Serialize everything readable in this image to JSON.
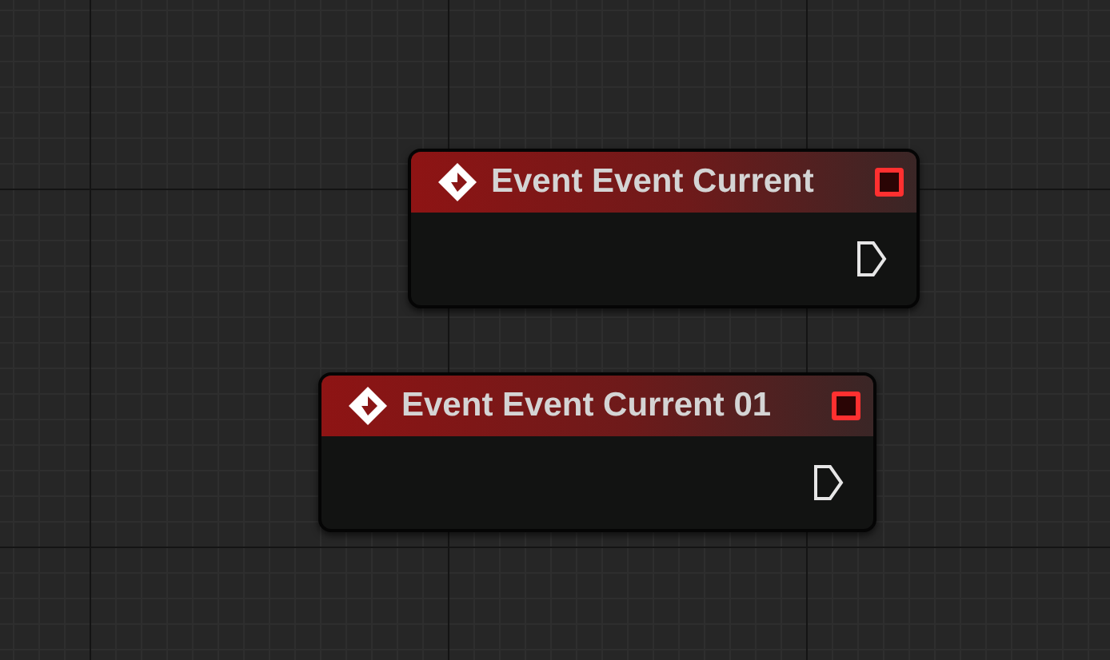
{
  "graph": {
    "nodes": [
      {
        "kind": "event",
        "title": "Event Event Current"
      },
      {
        "kind": "event",
        "title": "Event Event Current 01"
      }
    ]
  }
}
